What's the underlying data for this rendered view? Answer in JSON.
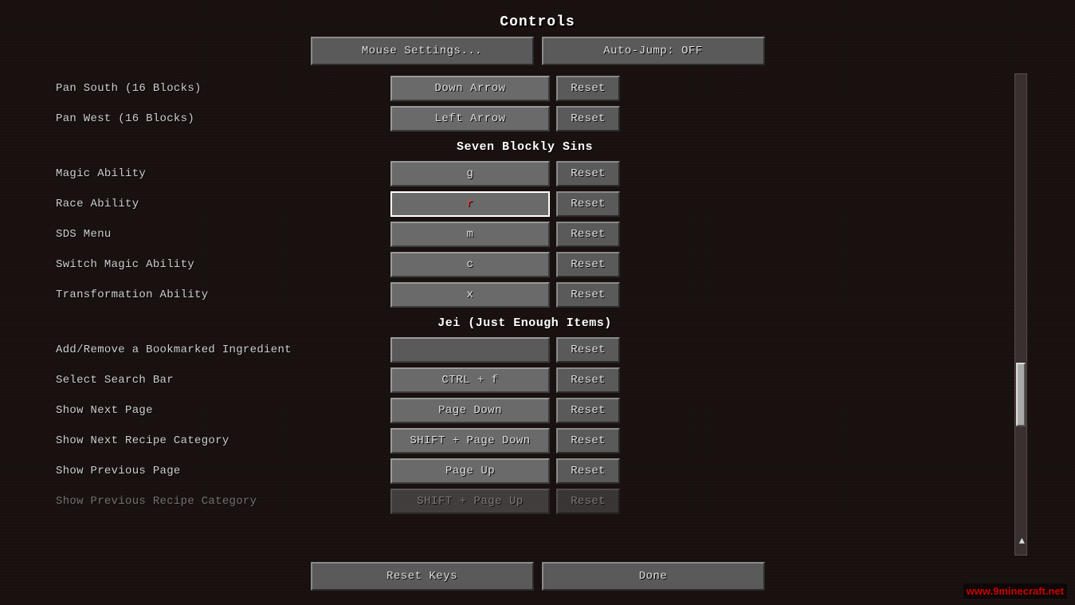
{
  "title": "Controls",
  "top_buttons": {
    "mouse_settings": "Mouse Settings...",
    "auto_jump": "Auto-Jump: OFF"
  },
  "sections": [
    {
      "id": "map_controls",
      "header": null,
      "rows": [
        {
          "label": "Pan South (16 Blocks)",
          "key": "Down Arrow",
          "key_style": "normal"
        },
        {
          "label": "Pan West (16 Blocks)",
          "key": "Left Arrow",
          "key_style": "normal"
        }
      ]
    },
    {
      "id": "seven_blockly_sins",
      "header": "Seven Blockly Sins",
      "rows": [
        {
          "label": "Magic Ability",
          "key": "g",
          "key_style": "normal"
        },
        {
          "label": "Race Ability",
          "key": "r",
          "key_style": "red",
          "highlight": true
        },
        {
          "label": "SDS Menu",
          "key": "m",
          "key_style": "normal"
        },
        {
          "label": "Switch Magic Ability",
          "key": "c",
          "key_style": "normal"
        },
        {
          "label": "Transformation Ability",
          "key": "x",
          "key_style": "normal"
        }
      ]
    },
    {
      "id": "jei",
      "header": "Jei (Just Enough Items)",
      "rows": [
        {
          "label": "Add/Remove a Bookmarked Ingredient",
          "key": "",
          "key_style": "empty"
        },
        {
          "label": "Select Search Bar",
          "key": "CTRL + f",
          "key_style": "normal"
        },
        {
          "label": "Show Next Page",
          "key": "Page Down",
          "key_style": "normal"
        },
        {
          "label": "Show Next Recipe Category",
          "key": "SHIFT + Page Down",
          "key_style": "normal"
        },
        {
          "label": "Show Previous Page",
          "key": "Page Up",
          "key_style": "normal"
        },
        {
          "label": "Show Previous Recipe Category",
          "key": "SHIFT + Page Up",
          "key_style": "partial"
        }
      ]
    }
  ],
  "bottom_buttons": {
    "reset_keys": "Reset Keys",
    "done": "Done"
  },
  "reset_label": "Reset",
  "watermark": "www.9minecraft.net"
}
